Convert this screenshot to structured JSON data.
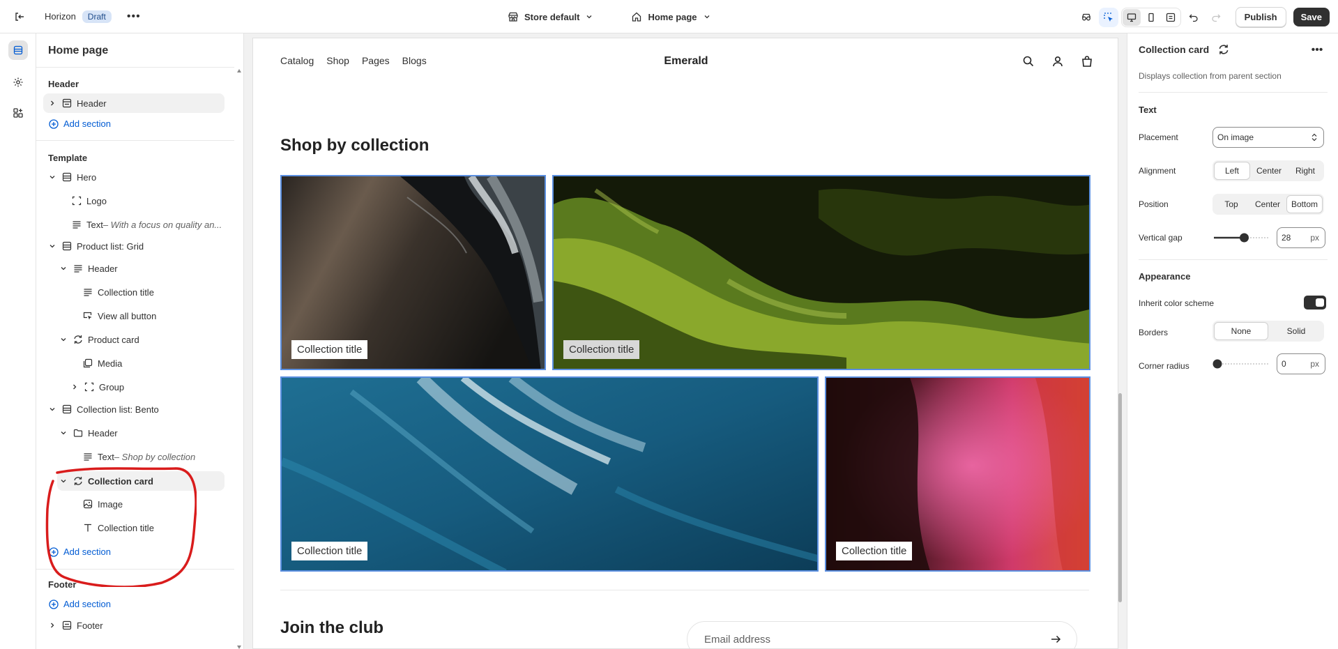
{
  "topbar": {
    "theme_name": "Horizon",
    "status_badge": "Draft",
    "store_selector": "Store default",
    "page_selector": "Home page",
    "publish_label": "Publish",
    "save_label": "Save"
  },
  "tree": {
    "title": "Home page",
    "header_section_label": "Header",
    "header_item": "Header",
    "add_section": "Add section",
    "template_label": "Template",
    "items": [
      {
        "label": "Hero",
        "sub": ""
      },
      {
        "label": "Logo",
        "sub": ""
      },
      {
        "label": "Text",
        "sub": " – With a focus on quality an..."
      },
      {
        "label": "Product list: Grid",
        "sub": ""
      },
      {
        "label": "Header",
        "sub": ""
      },
      {
        "label": "Collection title",
        "sub": ""
      },
      {
        "label": "View all button",
        "sub": ""
      },
      {
        "label": "Product card",
        "sub": ""
      },
      {
        "label": "Media",
        "sub": ""
      },
      {
        "label": "Group",
        "sub": ""
      },
      {
        "label": "Collection list: Bento",
        "sub": ""
      },
      {
        "label": "Header",
        "sub": ""
      },
      {
        "label": "Text",
        "sub": " – Shop by collection"
      },
      {
        "label": "Collection card",
        "sub": ""
      },
      {
        "label": "Image",
        "sub": ""
      },
      {
        "label": "Collection title",
        "sub": ""
      }
    ],
    "footer_label": "Footer",
    "footer_item": "Footer"
  },
  "preview": {
    "nav": [
      "Catalog",
      "Shop",
      "Pages",
      "Blogs"
    ],
    "store_name": "Emerald",
    "section_title": "Shop by collection",
    "cards": [
      "Collection title",
      "Collection title",
      "Collection title",
      "Collection title"
    ],
    "join_title": "Join the club",
    "email_placeholder": "Email address"
  },
  "panel": {
    "title": "Collection card",
    "description": "Displays collection from parent section",
    "text_section": "Text",
    "placement_label": "Placement",
    "placement_value": "On image",
    "alignment_label": "Alignment",
    "alignment_options": [
      "Left",
      "Center",
      "Right"
    ],
    "alignment_selected": "Left",
    "position_label": "Position",
    "position_options": [
      "Top",
      "Center",
      "Bottom"
    ],
    "position_selected": "Bottom",
    "vertical_gap_label": "Vertical gap",
    "vertical_gap_value": "28",
    "vertical_gap_fraction": 0.55,
    "unit": "px",
    "appearance_section": "Appearance",
    "inherit_label": "Inherit color scheme",
    "inherit_on": true,
    "borders_label": "Borders",
    "borders_options": [
      "None",
      "Solid"
    ],
    "borders_selected": "None",
    "corner_label": "Corner radius",
    "corner_value": "0",
    "corner_fraction": 0
  },
  "colors": {
    "accent": "#005bd3",
    "selection_border": "#5b8fe0",
    "annotation": "#d91c1c",
    "save_bg": "#303030"
  }
}
